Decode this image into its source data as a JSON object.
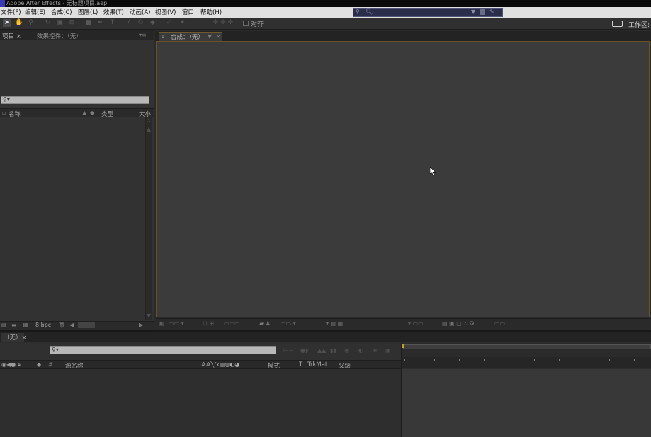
{
  "window": {
    "title": "Adobe After Effects - 无标题项目.aep"
  },
  "menubar": {
    "items": [
      "文件(F)",
      "编辑(E)",
      "合成(C)",
      "图层(L)",
      "效果(T)",
      "动画(A)",
      "视图(V)",
      "窗口",
      "帮助(H)"
    ]
  },
  "toolbar": {
    "snap_label": "对齐",
    "workspace_label": "工作区:"
  },
  "project_panel": {
    "tabs": [
      "项目 ×",
      "效果控件：（无）"
    ],
    "columns": {
      "name": "名称",
      "type": "类型",
      "size": "大小"
    },
    "bpc": "8 bpc"
  },
  "comp_panel": {
    "tab_label": "合成：（无）"
  },
  "timeline": {
    "tab_label": "（无）×",
    "columns": {
      "source_name": "源名称",
      "mode": "模式",
      "t": "T",
      "trkmat": "TrkMat",
      "parent": "父级"
    }
  },
  "colors": {
    "accent_border": "#6a5222",
    "panel_bg": "#2e2e2e",
    "viewer_bg": "#3b3b3b"
  }
}
